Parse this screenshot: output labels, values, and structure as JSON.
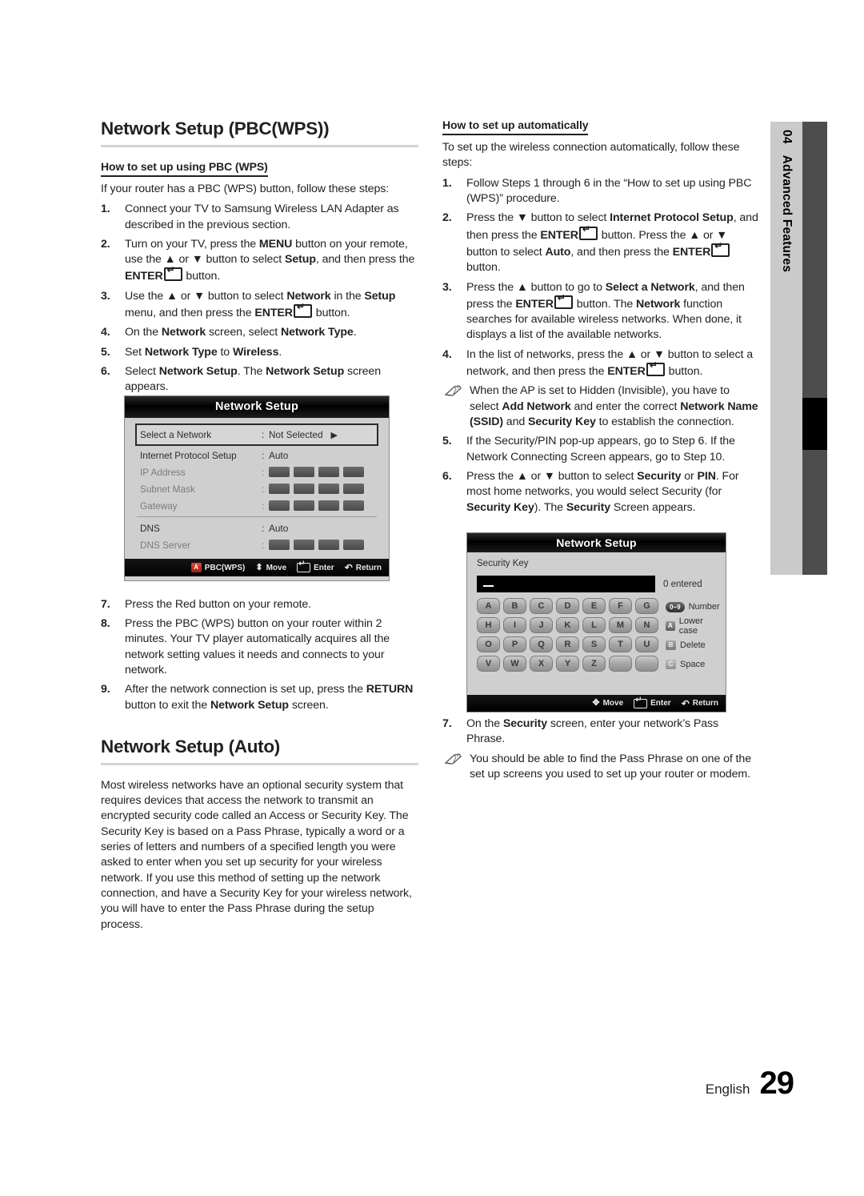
{
  "chapter_tab": {
    "number": "04",
    "label": "Advanced Features"
  },
  "footer": {
    "language": "English",
    "page_number": "29"
  },
  "left_column": {
    "section_title": "Network Setup (PBC(WPS))",
    "subsection_title": "How to set up using PBC (WPS)",
    "intro": "If your router has a PBC (WPS) button, follow these steps:",
    "steps": [
      {
        "num": "1.",
        "html": "Connect your TV to Samsung Wireless LAN Adapter as described in the previous section."
      },
      {
        "num": "2.",
        "html": "Turn on your TV, press the <b>MENU</b> button on your remote, use the ▲ or ▼ button to select <b>Setup</b>, and then press the <b>ENTER</b><span class=\"enter-key\"></span> button."
      },
      {
        "num": "3.",
        "html": "Use the ▲ or ▼ button to select <b>Network</b> in the <b>Setup</b> menu, and then press the <b>ENTER</b><span class=\"enter-key\"></span> button."
      },
      {
        "num": "4.",
        "html": "On the <b>Network</b> screen, select <b>Network Type</b>."
      },
      {
        "num": "5.",
        "html": "Set <b>Network Type</b> to <b>Wireless</b>."
      },
      {
        "num": "6.",
        "html": "Select <b>Network Setup</b>. The <b>Network Setup</b> screen appears."
      }
    ],
    "steps_after": [
      {
        "num": "7.",
        "html": "Press the Red button on your remote."
      },
      {
        "num": "8.",
        "html": "Press the PBC (WPS) button on your router within 2 minutes. Your TV player automatically acquires all the network setting values it needs and connects to your network."
      },
      {
        "num": "9.",
        "html": "After the network connection is set up, press the <b>RETURN</b> button to exit the <b>Network Setup</b> screen."
      }
    ],
    "section_title_2": "Network Setup (Auto)",
    "auto_paragraph": "Most wireless networks have an optional security system that requires devices that access the network to transmit an encrypted security code called an Access or Security Key. The Security Key is based on a Pass Phrase, typically a word or a series of letters and numbers of a specified length you were asked to enter when you set up security for your wireless network.  If you use this method of setting up the network connection, and have a Security Key for your wireless network, you will have to enter the Pass Phrase during the setup process."
  },
  "right_column": {
    "subsection_title": "How to set up automatically",
    "intro": "To set up the wireless connection automatically, follow these steps:",
    "steps": [
      {
        "num": "1.",
        "html": "Follow Steps 1 through 6 in the “How to set up using PBC (WPS)” procedure."
      },
      {
        "num": "2.",
        "html": "Press the ▼ button to select <b>Internet Protocol Setup</b>, and then press the <b>ENTER</b><span class=\"enter-key\"></span> button. Press the ▲ or ▼ button to select <b>Auto</b>, and then press the <b>ENTER</b><span class=\"enter-key\"></span> button."
      },
      {
        "num": "3.",
        "html": "Press the ▲ button to go to <b>Select a Network</b>, and then press the <b>ENTER</b><span class=\"enter-key\"></span> button. The <b>Network</b> function searches for available wireless networks. When done, it displays a list of the available networks."
      },
      {
        "num": "4.",
        "html": "In the list of networks, press the ▲ or ▼ button to select a network, and then press the <b>ENTER</b><span class=\"enter-key\"></span> button."
      }
    ],
    "note_1": "When the AP is set to Hidden (Invisible), you have to select <b>Add Network</b> and enter the correct <b>Network Name (SSID)</b> and <b>Security Key</b> to establish the connection.",
    "steps_2": [
      {
        "num": "5.",
        "html": "If the Security/PIN pop-up appears, go to Step 6. If the Network Connecting Screen appears, go to Step 10."
      },
      {
        "num": "6.",
        "html": "Press the ▲ or ▼ button to select <b>Security</b> or <b>PIN</b>. For most home networks, you would select Security (for <b>Security Key</b>). The <b>Security</b> Screen appears."
      }
    ],
    "steps_3": [
      {
        "num": "7.",
        "html": "On the <b>Security</b> screen, enter your network’s Pass Phrase."
      }
    ],
    "note_2": "You should be able to find the Pass Phrase on one of the set up screens you used to set up your router or modem."
  },
  "osd_network": {
    "title": "Network Setup",
    "rows": [
      {
        "label": "Select a Network",
        "value": "Not Selected",
        "selected": true,
        "arrow": "▶",
        "type": "text"
      },
      {
        "label": "Internet Protocol Setup",
        "value": "Auto",
        "selected": false,
        "type": "text"
      },
      {
        "label": "IP Address",
        "value": "",
        "dim": true,
        "type": "boxes",
        "box_count": 4
      },
      {
        "label": "Subnet Mask",
        "value": "",
        "dim": true,
        "type": "boxes",
        "box_count": 4
      },
      {
        "label": "Gateway",
        "value": "",
        "dim": true,
        "type": "boxes",
        "box_count": 4
      },
      {
        "label": "DNS",
        "value": "Auto",
        "selected": false,
        "type": "text",
        "divider_before": true
      },
      {
        "label": "DNS Server",
        "value": "",
        "dim": true,
        "type": "boxes",
        "box_count": 4
      }
    ],
    "footer_hints": [
      {
        "key": "A",
        "key_style": "red",
        "label": "PBC(WPS)"
      },
      {
        "key": "updown",
        "label": "Move"
      },
      {
        "key": "enter",
        "label": "Enter"
      },
      {
        "key": "return",
        "label": "Return"
      }
    ]
  },
  "osd_security": {
    "title": "Network Setup",
    "field_label": "Security Key",
    "input_value": "",
    "entered_count": "0 entered",
    "keyboard_rows": [
      [
        "A",
        "B",
        "C",
        "D",
        "E",
        "F",
        "G"
      ],
      [
        "H",
        "I",
        "J",
        "K",
        "L",
        "M",
        "N"
      ],
      [
        "O",
        "P",
        "Q",
        "R",
        "S",
        "T",
        "U"
      ],
      [
        "V",
        "W",
        "X",
        "Y",
        "Z",
        "",
        ""
      ]
    ],
    "legend": [
      {
        "key": "0~9",
        "key_type": "num",
        "label": "Number"
      },
      {
        "key": "A",
        "key_type": "a",
        "label": "Lower case"
      },
      {
        "key": "B",
        "key_type": "b",
        "label": "Delete"
      },
      {
        "key": "C",
        "key_type": "c",
        "label": "Space"
      }
    ],
    "footer_hints": [
      {
        "key": "move4",
        "label": "Move"
      },
      {
        "key": "enter",
        "label": "Enter"
      },
      {
        "key": "return",
        "label": "Return"
      }
    ]
  }
}
